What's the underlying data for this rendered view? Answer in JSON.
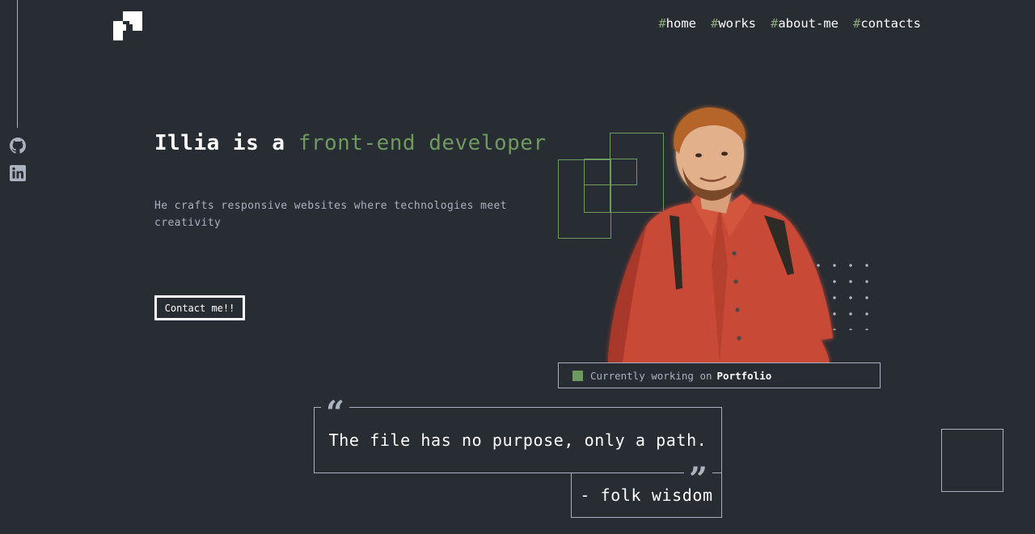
{
  "nav": {
    "items": [
      {
        "hash": "#",
        "label": "home"
      },
      {
        "hash": "#",
        "label": "works"
      },
      {
        "hash": "#",
        "label": "about-me"
      },
      {
        "hash": "#",
        "label": "contacts"
      }
    ]
  },
  "social": {
    "icons": [
      "github-icon",
      "linkedin-icon"
    ]
  },
  "hero": {
    "title_prefix": "Illia is a ",
    "title_accent": "front-end developer",
    "subtitle": "He crafts responsive websites where technologies meet creativity",
    "cta_label": "Contact me!!"
  },
  "status": {
    "prefix": "Currently working on",
    "project": "Portfolio"
  },
  "quote": {
    "text": "The file has no purpose, only a path.",
    "author": "- folk wisdom",
    "open_mark": "“",
    "close_mark": "”"
  },
  "colors": {
    "background": "#282c33",
    "accent": "#6f9a5f",
    "gray": "#abb2bf",
    "text": "#ffffff"
  }
}
